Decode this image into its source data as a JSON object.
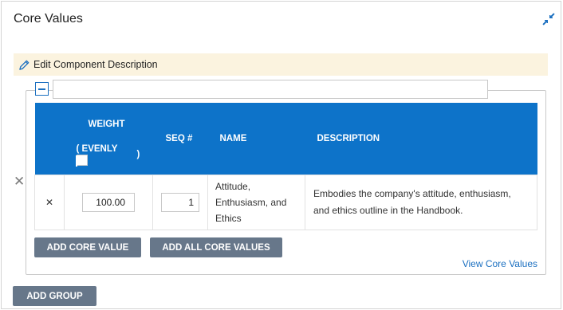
{
  "panel": {
    "title": "Core Values"
  },
  "edit_bar": {
    "label": "Edit Component Description"
  },
  "group": {
    "name_value": "",
    "table": {
      "headers": {
        "weight_line1": "WEIGHT",
        "weight_line2": "( EVENLY",
        "weight_line3": ")",
        "seq": "SEQ #",
        "name": "NAME",
        "description": "DESCRIPTION"
      },
      "rows": [
        {
          "weight": "100.00",
          "seq": "1",
          "name": "Attitude, Enthusiasm, and Ethics",
          "description": "Embodies the company's attitude, enthusiasm, and ethics outline in the Handbook."
        }
      ]
    },
    "buttons": {
      "add_core_value": "ADD CORE VALUE",
      "add_all_core_values": "ADD ALL CORE VALUES"
    },
    "view_link": "View Core Values"
  },
  "add_group_button": "ADD GROUP",
  "colors": {
    "header_blue": "#0d73c9",
    "button_slate": "#67778a",
    "edit_bar_bg": "#fbf3df",
    "link_blue": "#1a6fc0"
  },
  "icons": {
    "collapse": "collapse-arrows-icon",
    "edit": "pencil-icon",
    "remove": "close-icon",
    "group_toggle": "minus-square-icon"
  }
}
